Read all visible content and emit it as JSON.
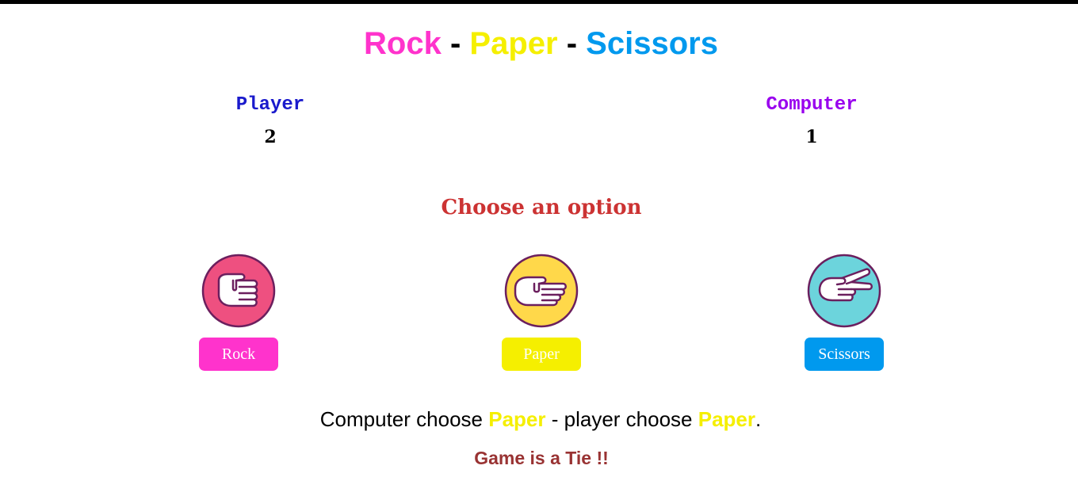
{
  "title": {
    "word1": "Rock",
    "sep1": "-",
    "word2": "Paper",
    "sep2": "-",
    "word3": "Scissors"
  },
  "scoreboard": {
    "player_label": "Player",
    "player_score": "2",
    "computer_label": "Computer",
    "computer_score": "1"
  },
  "prompt": "Choose an option",
  "options": [
    {
      "label": "Rock",
      "icon": "fist-hand-icon",
      "color": "#ff33cc"
    },
    {
      "label": "Paper",
      "icon": "flat-hand-icon",
      "color": "#f5ef00"
    },
    {
      "label": "Scissors",
      "icon": "two-finger-hand-icon",
      "color": "#0099ee"
    }
  ],
  "result": {
    "prefix": "Computer choose",
    "computer_choice": "Paper",
    "middle": "- player choose",
    "player_choice": "Paper",
    "suffix": "."
  },
  "outcome": "Game is a Tie !!",
  "colors": {
    "rock": "#ff33cc",
    "paper": "#f5ef00",
    "scissors": "#0099ee",
    "player_label": "#1a1acc",
    "computer_label": "#9900ee",
    "prompt": "#cc3333",
    "outcome": "#993333",
    "rock_circle": "#ee5080",
    "paper_circle": "#ffd84a",
    "scissors_circle": "#6cd4dc",
    "icon_outline": "#6b1f5e"
  }
}
